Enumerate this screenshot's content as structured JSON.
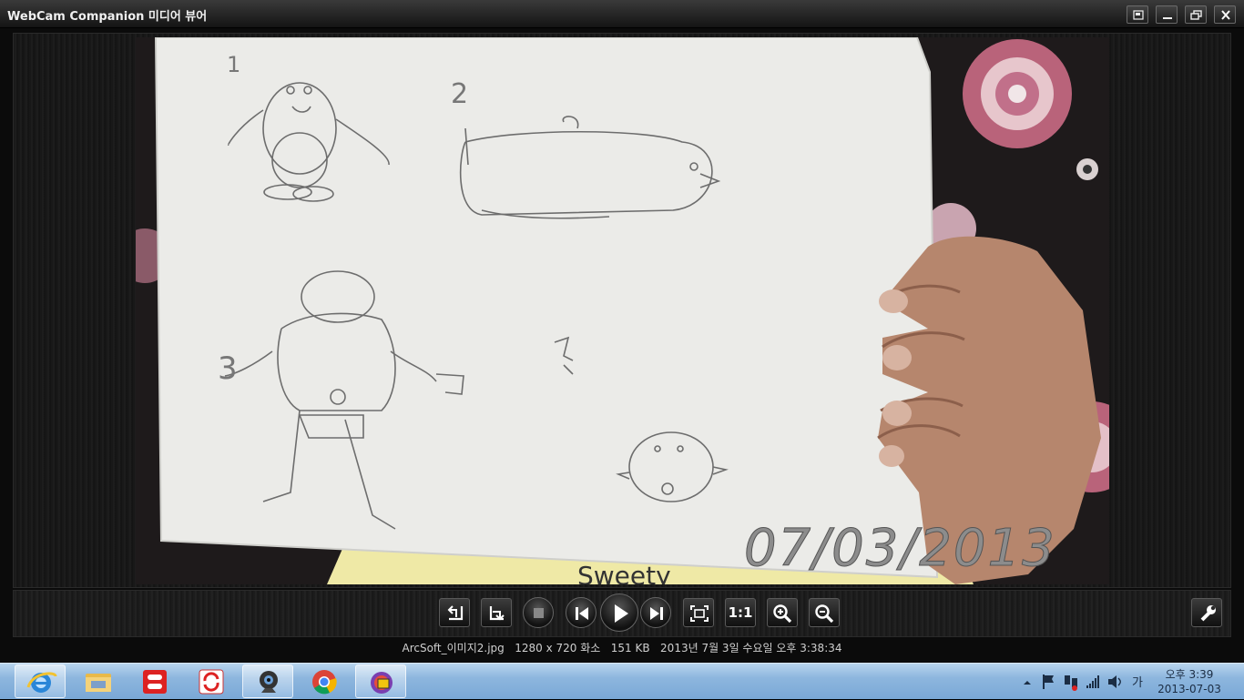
{
  "window": {
    "title": "WebCam Companion 미디어 뷰어"
  },
  "photo": {
    "timestamp_overlay": "07/03/2013",
    "drawing_labels": {
      "n1": "1",
      "n2": "2",
      "n3": "3",
      "signature": "Sweety"
    }
  },
  "status": {
    "filename": "ArcSoft_이미지2.jpg",
    "dimensions": "1280 x 720 화소",
    "size": "151 KB",
    "date": "2013년 7월 3일 수요일 오후 3:38:34"
  },
  "taskbar": {
    "apps": [
      "internet-explorer",
      "file-explorer",
      "arcsoft-app",
      "sync-app",
      "webcam-companion",
      "chrome",
      "media-viewer"
    ],
    "ime": "가",
    "clock_time": "오후 3:39",
    "clock_date": "2013-07-03"
  },
  "controls": {
    "actual_size_label": "1:1"
  }
}
